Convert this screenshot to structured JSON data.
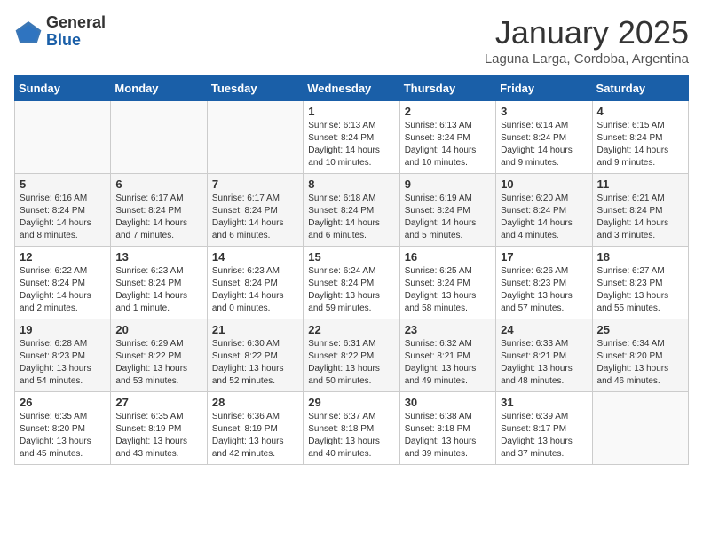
{
  "logo": {
    "general": "General",
    "blue": "Blue"
  },
  "title": "January 2025",
  "subtitle": "Laguna Larga, Cordoba, Argentina",
  "weekdays": [
    "Sunday",
    "Monday",
    "Tuesday",
    "Wednesday",
    "Thursday",
    "Friday",
    "Saturday"
  ],
  "weeks": [
    [
      {
        "day": "",
        "info": ""
      },
      {
        "day": "",
        "info": ""
      },
      {
        "day": "",
        "info": ""
      },
      {
        "day": "1",
        "info": "Sunrise: 6:13 AM\nSunset: 8:24 PM\nDaylight: 14 hours\nand 10 minutes."
      },
      {
        "day": "2",
        "info": "Sunrise: 6:13 AM\nSunset: 8:24 PM\nDaylight: 14 hours\nand 10 minutes."
      },
      {
        "day": "3",
        "info": "Sunrise: 6:14 AM\nSunset: 8:24 PM\nDaylight: 14 hours\nand 9 minutes."
      },
      {
        "day": "4",
        "info": "Sunrise: 6:15 AM\nSunset: 8:24 PM\nDaylight: 14 hours\nand 9 minutes."
      }
    ],
    [
      {
        "day": "5",
        "info": "Sunrise: 6:16 AM\nSunset: 8:24 PM\nDaylight: 14 hours\nand 8 minutes."
      },
      {
        "day": "6",
        "info": "Sunrise: 6:17 AM\nSunset: 8:24 PM\nDaylight: 14 hours\nand 7 minutes."
      },
      {
        "day": "7",
        "info": "Sunrise: 6:17 AM\nSunset: 8:24 PM\nDaylight: 14 hours\nand 6 minutes."
      },
      {
        "day": "8",
        "info": "Sunrise: 6:18 AM\nSunset: 8:24 PM\nDaylight: 14 hours\nand 6 minutes."
      },
      {
        "day": "9",
        "info": "Sunrise: 6:19 AM\nSunset: 8:24 PM\nDaylight: 14 hours\nand 5 minutes."
      },
      {
        "day": "10",
        "info": "Sunrise: 6:20 AM\nSunset: 8:24 PM\nDaylight: 14 hours\nand 4 minutes."
      },
      {
        "day": "11",
        "info": "Sunrise: 6:21 AM\nSunset: 8:24 PM\nDaylight: 14 hours\nand 3 minutes."
      }
    ],
    [
      {
        "day": "12",
        "info": "Sunrise: 6:22 AM\nSunset: 8:24 PM\nDaylight: 14 hours\nand 2 minutes."
      },
      {
        "day": "13",
        "info": "Sunrise: 6:23 AM\nSunset: 8:24 PM\nDaylight: 14 hours\nand 1 minute."
      },
      {
        "day": "14",
        "info": "Sunrise: 6:23 AM\nSunset: 8:24 PM\nDaylight: 14 hours\nand 0 minutes."
      },
      {
        "day": "15",
        "info": "Sunrise: 6:24 AM\nSunset: 8:24 PM\nDaylight: 13 hours\nand 59 minutes."
      },
      {
        "day": "16",
        "info": "Sunrise: 6:25 AM\nSunset: 8:24 PM\nDaylight: 13 hours\nand 58 minutes."
      },
      {
        "day": "17",
        "info": "Sunrise: 6:26 AM\nSunset: 8:23 PM\nDaylight: 13 hours\nand 57 minutes."
      },
      {
        "day": "18",
        "info": "Sunrise: 6:27 AM\nSunset: 8:23 PM\nDaylight: 13 hours\nand 55 minutes."
      }
    ],
    [
      {
        "day": "19",
        "info": "Sunrise: 6:28 AM\nSunset: 8:23 PM\nDaylight: 13 hours\nand 54 minutes."
      },
      {
        "day": "20",
        "info": "Sunrise: 6:29 AM\nSunset: 8:22 PM\nDaylight: 13 hours\nand 53 minutes."
      },
      {
        "day": "21",
        "info": "Sunrise: 6:30 AM\nSunset: 8:22 PM\nDaylight: 13 hours\nand 52 minutes."
      },
      {
        "day": "22",
        "info": "Sunrise: 6:31 AM\nSunset: 8:22 PM\nDaylight: 13 hours\nand 50 minutes."
      },
      {
        "day": "23",
        "info": "Sunrise: 6:32 AM\nSunset: 8:21 PM\nDaylight: 13 hours\nand 49 minutes."
      },
      {
        "day": "24",
        "info": "Sunrise: 6:33 AM\nSunset: 8:21 PM\nDaylight: 13 hours\nand 48 minutes."
      },
      {
        "day": "25",
        "info": "Sunrise: 6:34 AM\nSunset: 8:20 PM\nDaylight: 13 hours\nand 46 minutes."
      }
    ],
    [
      {
        "day": "26",
        "info": "Sunrise: 6:35 AM\nSunset: 8:20 PM\nDaylight: 13 hours\nand 45 minutes."
      },
      {
        "day": "27",
        "info": "Sunrise: 6:35 AM\nSunset: 8:19 PM\nDaylight: 13 hours\nand 43 minutes."
      },
      {
        "day": "28",
        "info": "Sunrise: 6:36 AM\nSunset: 8:19 PM\nDaylight: 13 hours\nand 42 minutes."
      },
      {
        "day": "29",
        "info": "Sunrise: 6:37 AM\nSunset: 8:18 PM\nDaylight: 13 hours\nand 40 minutes."
      },
      {
        "day": "30",
        "info": "Sunrise: 6:38 AM\nSunset: 8:18 PM\nDaylight: 13 hours\nand 39 minutes."
      },
      {
        "day": "31",
        "info": "Sunrise: 6:39 AM\nSunset: 8:17 PM\nDaylight: 13 hours\nand 37 minutes."
      },
      {
        "day": "",
        "info": ""
      }
    ]
  ]
}
